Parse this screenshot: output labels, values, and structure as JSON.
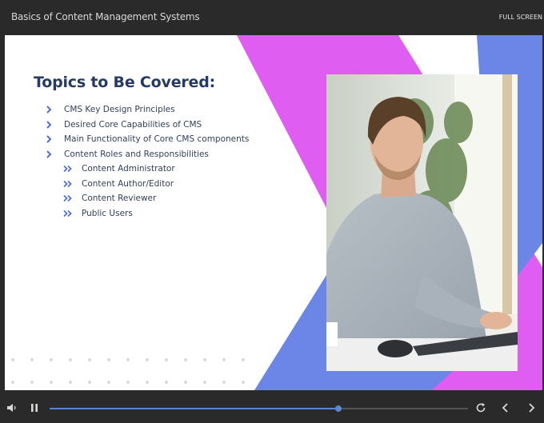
{
  "header": {
    "course_title": "Basics of Content Management Systems",
    "fullscreen_label": "FULL SCREEN"
  },
  "slide": {
    "heading": "Topics to Be Covered:",
    "bullets": [
      "CMS Key Design Principles",
      "Desired Core Capabilities of CMS",
      "Main Functionality of Core CMS components",
      "Content Roles and Responsibilities"
    ],
    "sub_bullets": [
      "Content Administrator",
      "Content Author/Editor",
      "Content Reviewer",
      "Public Users"
    ],
    "photo_subject": "man-typing-at-computer"
  },
  "player": {
    "progress_percent": 69,
    "icons": [
      "volume-icon",
      "pause-icon",
      "replay-icon",
      "chevron-left-icon",
      "chevron-right-icon"
    ]
  },
  "colors": {
    "accent_blue": "#6b86e6",
    "accent_magenta": "#df5ef1",
    "heading_navy": "#263a66",
    "bar_bg": "#2a2a2a"
  }
}
